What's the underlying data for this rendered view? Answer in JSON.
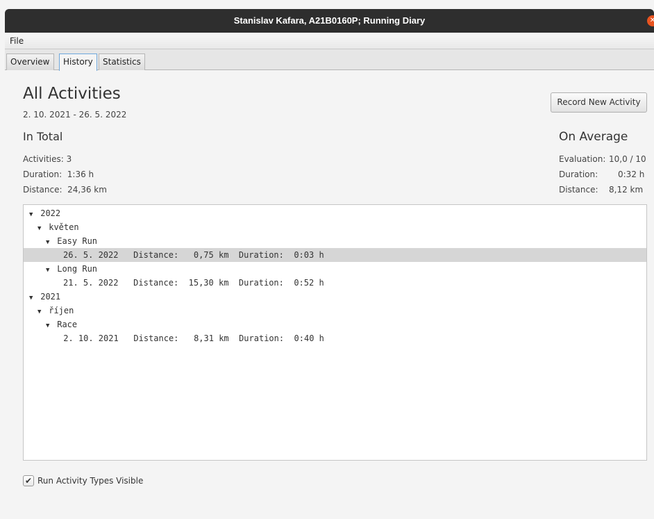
{
  "window": {
    "title": "Stanislav Kafara, A21B0160P; Running Diary"
  },
  "menu": {
    "file": "File"
  },
  "tabs": [
    {
      "label": "Overview",
      "active": false
    },
    {
      "label": "History",
      "active": true
    },
    {
      "label": "Statistics",
      "active": false
    }
  ],
  "header": {
    "title": "All Activities",
    "date_range": "2. 10. 2021 - 26. 5. 2022",
    "record_button": "Record New Activity"
  },
  "in_total": {
    "title": "In Total",
    "activities": "Activities: 3",
    "duration": "Duration:  1:36 h",
    "distance": "Distance:  24,36 km"
  },
  "on_average": {
    "title": "On Average",
    "evaluation_label": "Evaluation:",
    "evaluation_value": "10,0 / 10",
    "duration_label": "Duration:",
    "duration_value": "0:32 h",
    "distance_label": "Distance:",
    "distance_value": "8,12 km"
  },
  "tree": {
    "rows": [
      {
        "level": 0,
        "expanded": true,
        "text": "2022"
      },
      {
        "level": 1,
        "expanded": true,
        "text": "květen"
      },
      {
        "level": 2,
        "expanded": true,
        "text": "Easy Run"
      },
      {
        "level": 3,
        "selected": true,
        "text": "26. 5. 2022   Distance:   0,75 km  Duration:  0:03 h"
      },
      {
        "level": 2,
        "expanded": true,
        "text": "Long Run"
      },
      {
        "level": 3,
        "text": "21. 5. 2022   Distance:  15,30 km  Duration:  0:52 h"
      },
      {
        "level": 0,
        "expanded": true,
        "text": "2021"
      },
      {
        "level": 1,
        "expanded": true,
        "text": "říjen"
      },
      {
        "level": 2,
        "expanded": true,
        "text": "Race"
      },
      {
        "level": 3,
        "text": " 2. 10. 2021   Distance:   8,31 km  Duration:  0:40 h"
      }
    ]
  },
  "options": {
    "run_types_visible": "Run Activity Types Visible",
    "checked": true
  },
  "icons": {
    "close": "close-icon",
    "expand": "triangle-down-icon",
    "check": "checkmark-icon"
  },
  "colors": {
    "close_button": "#e95420",
    "titlebar": "#2e2e2e",
    "selected_row": "#d6d6d6"
  }
}
